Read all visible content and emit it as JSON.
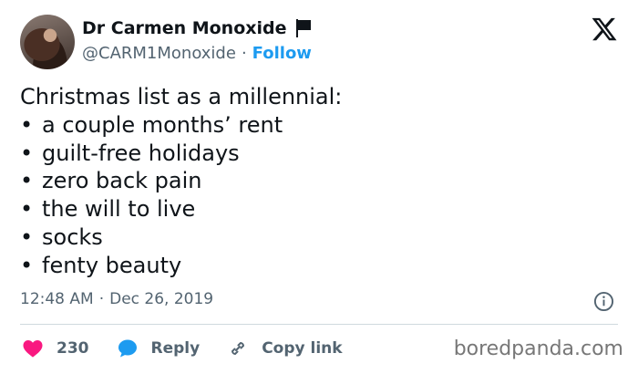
{
  "author": {
    "name": "Dr Carmen Monoxide",
    "handle": "@CARM1Monoxide",
    "separator": "·",
    "follow_label": "Follow"
  },
  "tweet": {
    "intro": "Christmas list as a millennial:",
    "bullet_glyph": "•",
    "items": [
      "a couple months’ rent",
      "guilt-free holidays",
      "zero back pain",
      "the will to live",
      "socks",
      "fenty beauty"
    ]
  },
  "meta": {
    "time": "12:48 AM",
    "separator": "·",
    "date": "Dec 26, 2019"
  },
  "actions": {
    "likes": "230",
    "reply_label": "Reply",
    "copy_link_label": "Copy link"
  },
  "watermark": "boredpanda.com",
  "icons": {
    "logo": "x-logo-icon",
    "flag": "black-flag-icon",
    "info": "info-icon",
    "heart": "heart-icon",
    "reply": "speech-bubble-icon",
    "link": "link-icon"
  },
  "colors": {
    "accent": "#1d9bf0",
    "heart": "#f91880",
    "text": "#0f1419",
    "muted": "#536471",
    "divider": "#cfd9de"
  }
}
